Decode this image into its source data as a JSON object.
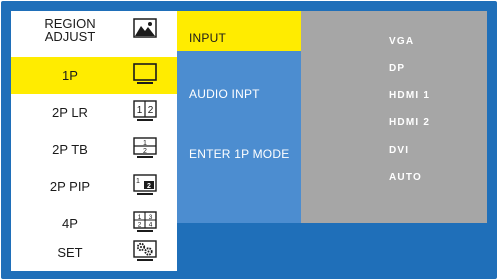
{
  "menu": {
    "header": {
      "line1": "REGION",
      "line2": "ADJUST",
      "icon": "landscape-picture-icon"
    },
    "items": [
      {
        "label": "1P",
        "icon": "single-monitor-icon"
      },
      {
        "label": "2P LR",
        "icon": "split-left-right-icon"
      },
      {
        "label": "2P TB",
        "icon": "split-top-bottom-icon"
      },
      {
        "label": "2P PIP",
        "icon": "picture-in-picture-icon"
      },
      {
        "label": "4P",
        "icon": "quad-split-icon"
      },
      {
        "label": "SET",
        "icon": "settings-gears-icon"
      }
    ],
    "selected": "1P"
  },
  "submenu": {
    "input": "INPUT",
    "audio": "AUDIO INPT",
    "enter": "ENTER 1P MODE"
  },
  "options": [
    "VGA",
    "DP",
    "HDMI 1",
    "HDMI 2",
    "DVI",
    "AUTO"
  ],
  "colors": {
    "frame": "#1f6fb9",
    "highlight": "#ffec00",
    "submenu_bg": "#4c8dd0",
    "options_bg": "#a6a6a6"
  }
}
